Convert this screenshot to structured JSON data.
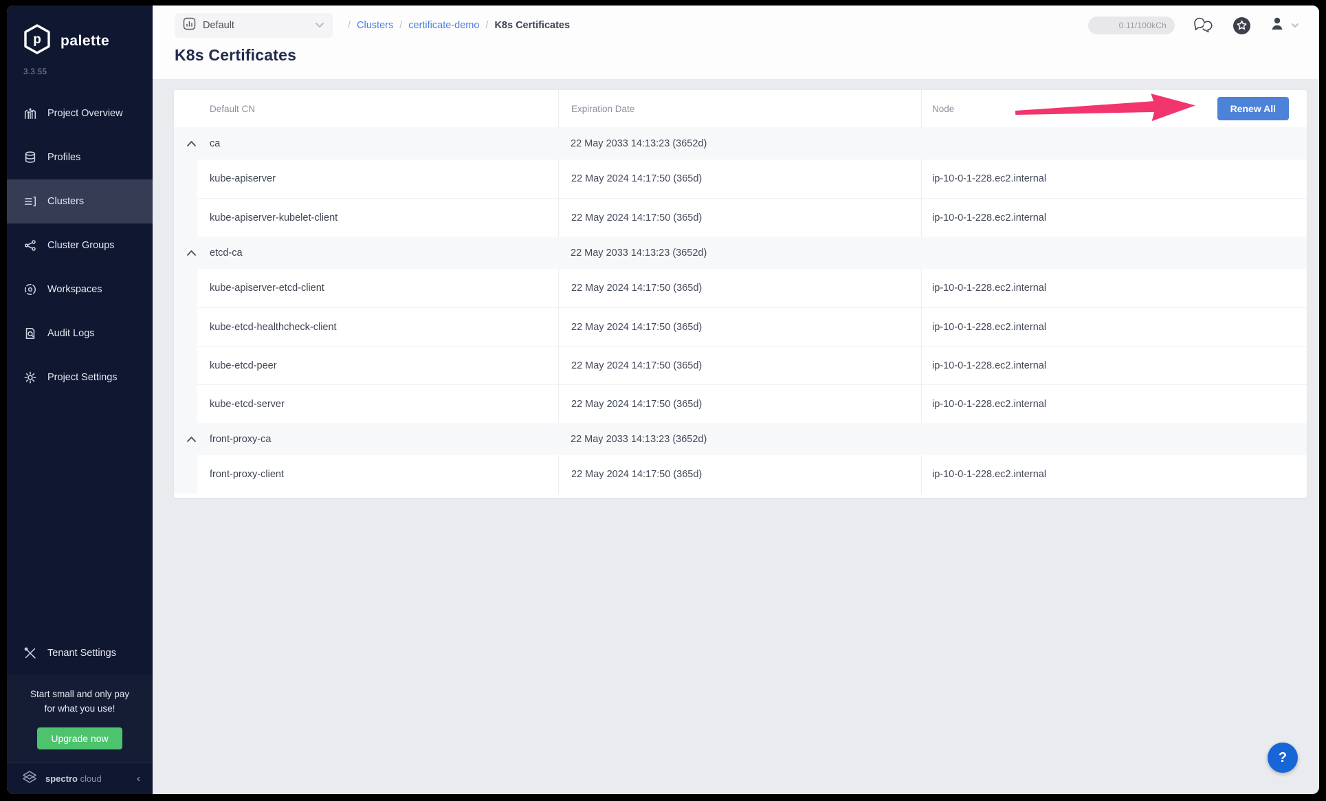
{
  "brand": {
    "name": "palette",
    "version": "3.3.55"
  },
  "sidebar": {
    "nav": [
      {
        "label": "Project Overview",
        "icon": "chart-overview-icon",
        "active": false
      },
      {
        "label": "Profiles",
        "icon": "profiles-stack-icon",
        "active": false
      },
      {
        "label": "Clusters",
        "icon": "clusters-list-icon",
        "active": true
      },
      {
        "label": "Cluster Groups",
        "icon": "cluster-groups-network-icon",
        "active": false
      },
      {
        "label": "Workspaces",
        "icon": "workspaces-icon",
        "active": false
      },
      {
        "label": "Audit Logs",
        "icon": "audit-logs-icon",
        "active": false
      },
      {
        "label": "Project Settings",
        "icon": "gear-icon",
        "active": false
      }
    ],
    "tenant": {
      "label": "Tenant Settings",
      "icon": "tools-icon"
    },
    "promo": {
      "line1": "Start small and only pay",
      "line2": "for what you use!",
      "cta": "Upgrade now"
    },
    "footer": {
      "brand_bold": "spectro",
      "brand_light": "cloud",
      "collapse": "‹"
    }
  },
  "topbar": {
    "project_selector": {
      "value": "Default"
    },
    "breadcrumb": [
      {
        "label": "Clusters",
        "type": "link"
      },
      {
        "label": "certificate-demo",
        "type": "link"
      },
      {
        "label": "K8s Certificates",
        "type": "current"
      }
    ],
    "usage": "0.11/100kCh"
  },
  "page": {
    "title": "K8s Certificates"
  },
  "table": {
    "columns": [
      "Default CN",
      "Expiration Date",
      "Node"
    ],
    "renew_all": "Renew All",
    "groups": [
      {
        "name": "ca",
        "expiration": "22 May 2033 14:13:23 (3652d)",
        "children": [
          {
            "name": "kube-apiserver",
            "expiration": "22 May 2024 14:17:50 (365d)",
            "node": "ip-10-0-1-228.ec2.internal"
          },
          {
            "name": "kube-apiserver-kubelet-client",
            "expiration": "22 May 2024 14:17:50 (365d)",
            "node": "ip-10-0-1-228.ec2.internal"
          }
        ]
      },
      {
        "name": "etcd-ca",
        "expiration": "22 May 2033 14:13:23 (3652d)",
        "children": [
          {
            "name": "kube-apiserver-etcd-client",
            "expiration": "22 May 2024 14:17:50 (365d)",
            "node": "ip-10-0-1-228.ec2.internal"
          },
          {
            "name": "kube-etcd-healthcheck-client",
            "expiration": "22 May 2024 14:17:50 (365d)",
            "node": "ip-10-0-1-228.ec2.internal"
          },
          {
            "name": "kube-etcd-peer",
            "expiration": "22 May 2024 14:17:50 (365d)",
            "node": "ip-10-0-1-228.ec2.internal"
          },
          {
            "name": "kube-etcd-server",
            "expiration": "22 May 2024 14:17:50 (365d)",
            "node": "ip-10-0-1-228.ec2.internal"
          }
        ]
      },
      {
        "name": "front-proxy-ca",
        "expiration": "22 May 2033 14:13:23 (3652d)",
        "children": [
          {
            "name": "front-proxy-client",
            "expiration": "22 May 2024 14:17:50 (365d)",
            "node": "ip-10-0-1-228.ec2.internal"
          }
        ]
      }
    ]
  },
  "help": {
    "label": "?"
  },
  "colors": {
    "sidebar_bg": "#101831",
    "active_item_bg": "#363c54",
    "accent_blue": "#4d82d9",
    "link_blue": "#4a7ee0",
    "arrow_pink": "#f2356d",
    "upgrade_green": "#4dc36e",
    "help_blue": "#1865d8",
    "page_bg": "#e9ebee",
    "group_row_bg": "#f7f8f9"
  }
}
